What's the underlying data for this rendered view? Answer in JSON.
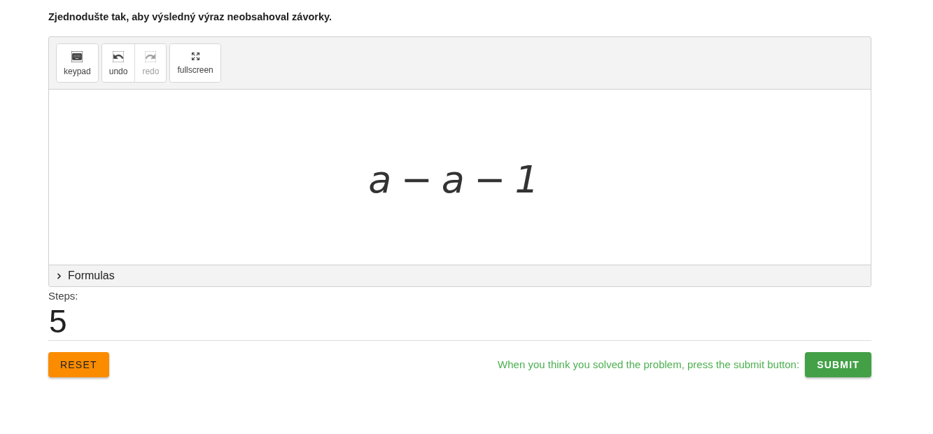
{
  "instruction": "Zjednodušte tak, aby výsledný výraz neobsahoval závorky.",
  "toolbar": {
    "groups": [
      [
        {
          "kind": "keypad",
          "label": "keypad",
          "disabled": false
        }
      ],
      [
        {
          "kind": "undo",
          "label": "undo",
          "disabled": false
        },
        {
          "kind": "redo",
          "label": "redo",
          "disabled": true
        }
      ],
      [
        {
          "kind": "fullscreen",
          "label": "fullscreen",
          "disabled": false
        }
      ]
    ]
  },
  "canvas": {
    "expression": "a − a − 1"
  },
  "formulas": {
    "label": "Formulas",
    "expanded": false
  },
  "steps": {
    "label": "Steps:",
    "value": "5"
  },
  "footer": {
    "reset_label": "RESET",
    "hint": "When you think you solved the problem, press the submit button:",
    "submit_label": "SUBMIT"
  }
}
